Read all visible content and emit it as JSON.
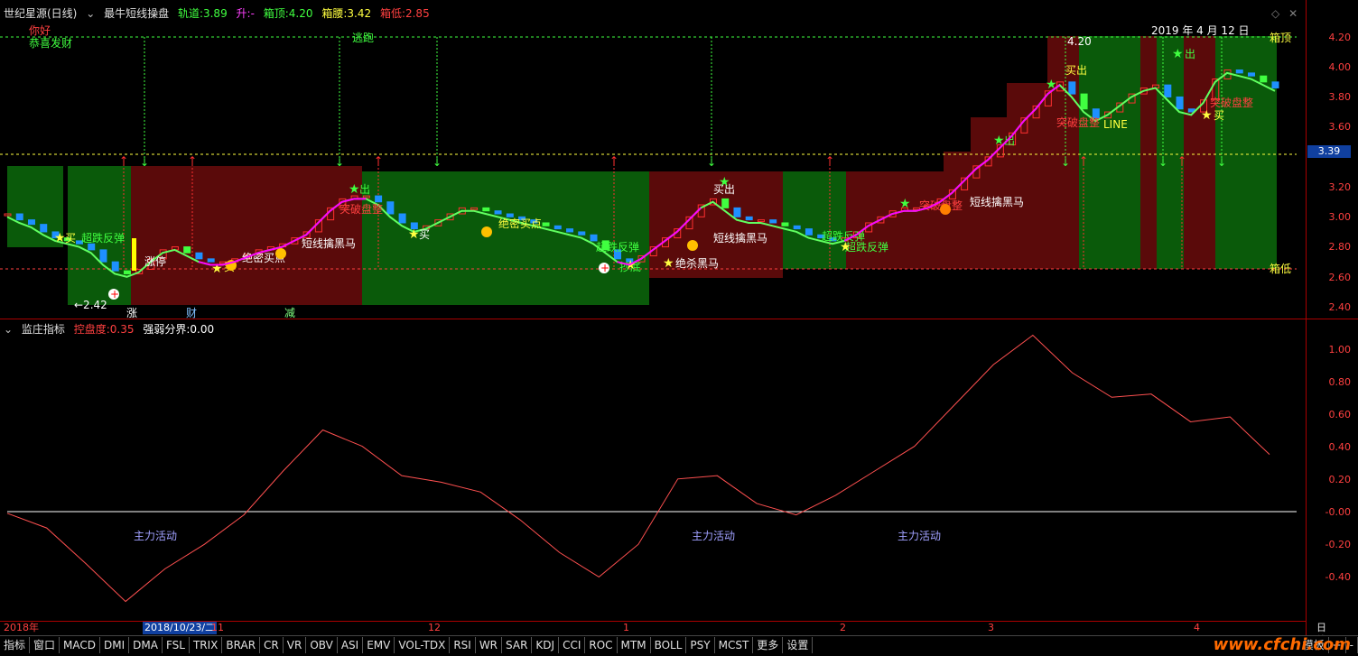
{
  "header": {
    "stock": "世纪星源(日线)",
    "indicator": "最牛短线操盘",
    "track_label": "轨道:",
    "track_value": "3.89",
    "rise_label": "升:",
    "rise_value": "-",
    "box_top_label": "箱顶:",
    "box_top_value": "4.20",
    "box_mid_label": "箱腰:",
    "box_mid_value": "3.42",
    "box_low_label": "箱低:",
    "box_low_value": "2.85"
  },
  "sub_header": {
    "name": "监庄指标",
    "control_label": "控盘度:",
    "control_value": "0.35",
    "strength_label": "强弱分界:",
    "strength_value": "0.00"
  },
  "main_axis": [
    "4.20",
    "4.00",
    "3.80",
    "3.60",
    "3.20",
    "3.00",
    "2.80",
    "2.60",
    "2.40"
  ],
  "sub_axis": [
    "1.00",
    "0.80",
    "0.60",
    "0.40",
    "0.20",
    "-0.00",
    "-0.20",
    "-0.40"
  ],
  "price_flag": "3.39",
  "labels": {
    "greeting1": "你好",
    "greeting2": "恭喜发财",
    "escape": "逃跑",
    "date": "2019 年 4 月 12 日",
    "box_top_tag": "箱顶",
    "box_low_tag": "箱低",
    "low_mark": "←2.42",
    "high_mark": "4.20",
    "line_tag": "LINE",
    "zhang": "涨",
    "cai": "财",
    "jian": "减",
    "buy": "买",
    "sell": "出",
    "buy_sell": "买出",
    "oversold": "超跌反弹",
    "limit_up": "涨停",
    "secret_buy": "绝密买点",
    "dark_horse": "短线擒黑马",
    "kill_dark_horse": "绝杀黑马",
    "breakout": "突破盘整",
    "bottom": "抄底",
    "main_force1": "主力活动",
    "main_force2": "主力活动",
    "main_force3": "主力活动"
  },
  "bottom_axis": [
    "2018年",
    "2018/10/23/二",
    "11",
    "12",
    "1",
    "2",
    "3",
    "4",
    "日线"
  ],
  "tabs": [
    "指标",
    "窗口",
    "MACD",
    "DMI",
    "DMA",
    "FSL",
    "TRIX",
    "BRAR",
    "CR",
    "VR",
    "OBV",
    "ASI",
    "EMV",
    "VOL-TDX",
    "RSI",
    "WR",
    "SAR",
    "KDJ",
    "CCI",
    "ROC",
    "MTM",
    "BOLL",
    "PSY",
    "MCST",
    "更多",
    "设置"
  ],
  "right_tags": [
    "模板",
    "+",
    "-"
  ],
  "watermark": "www.cfchi.com",
  "colors": {
    "up": "#ff3030",
    "down": "#1e90ff",
    "green_zone": "#0a5a0a",
    "red_zone": "#5a0a0a",
    "magenta": "#ff00ff",
    "lime": "#40ff40"
  },
  "chart_data": {
    "type": "line",
    "title": "",
    "series": [
      {
        "values": [
          -0.01,
          -0.1,
          -0.32,
          -0.55,
          -0.35,
          -0.2,
          -0.02,
          0.25,
          0.5,
          0.4,
          0.22,
          0.18,
          0.12,
          -0.05,
          -0.25,
          -0.4,
          -0.2,
          0.2,
          0.22,
          0.05,
          -0.02,
          0.1,
          0.25,
          0.4,
          0.65,
          0.9,
          1.08,
          0.85,
          0.7,
          0.72,
          0.55,
          0.58,
          0.35
        ]
      }
    ],
    "ylim": [
      -0.65,
      1.1
    ]
  }
}
